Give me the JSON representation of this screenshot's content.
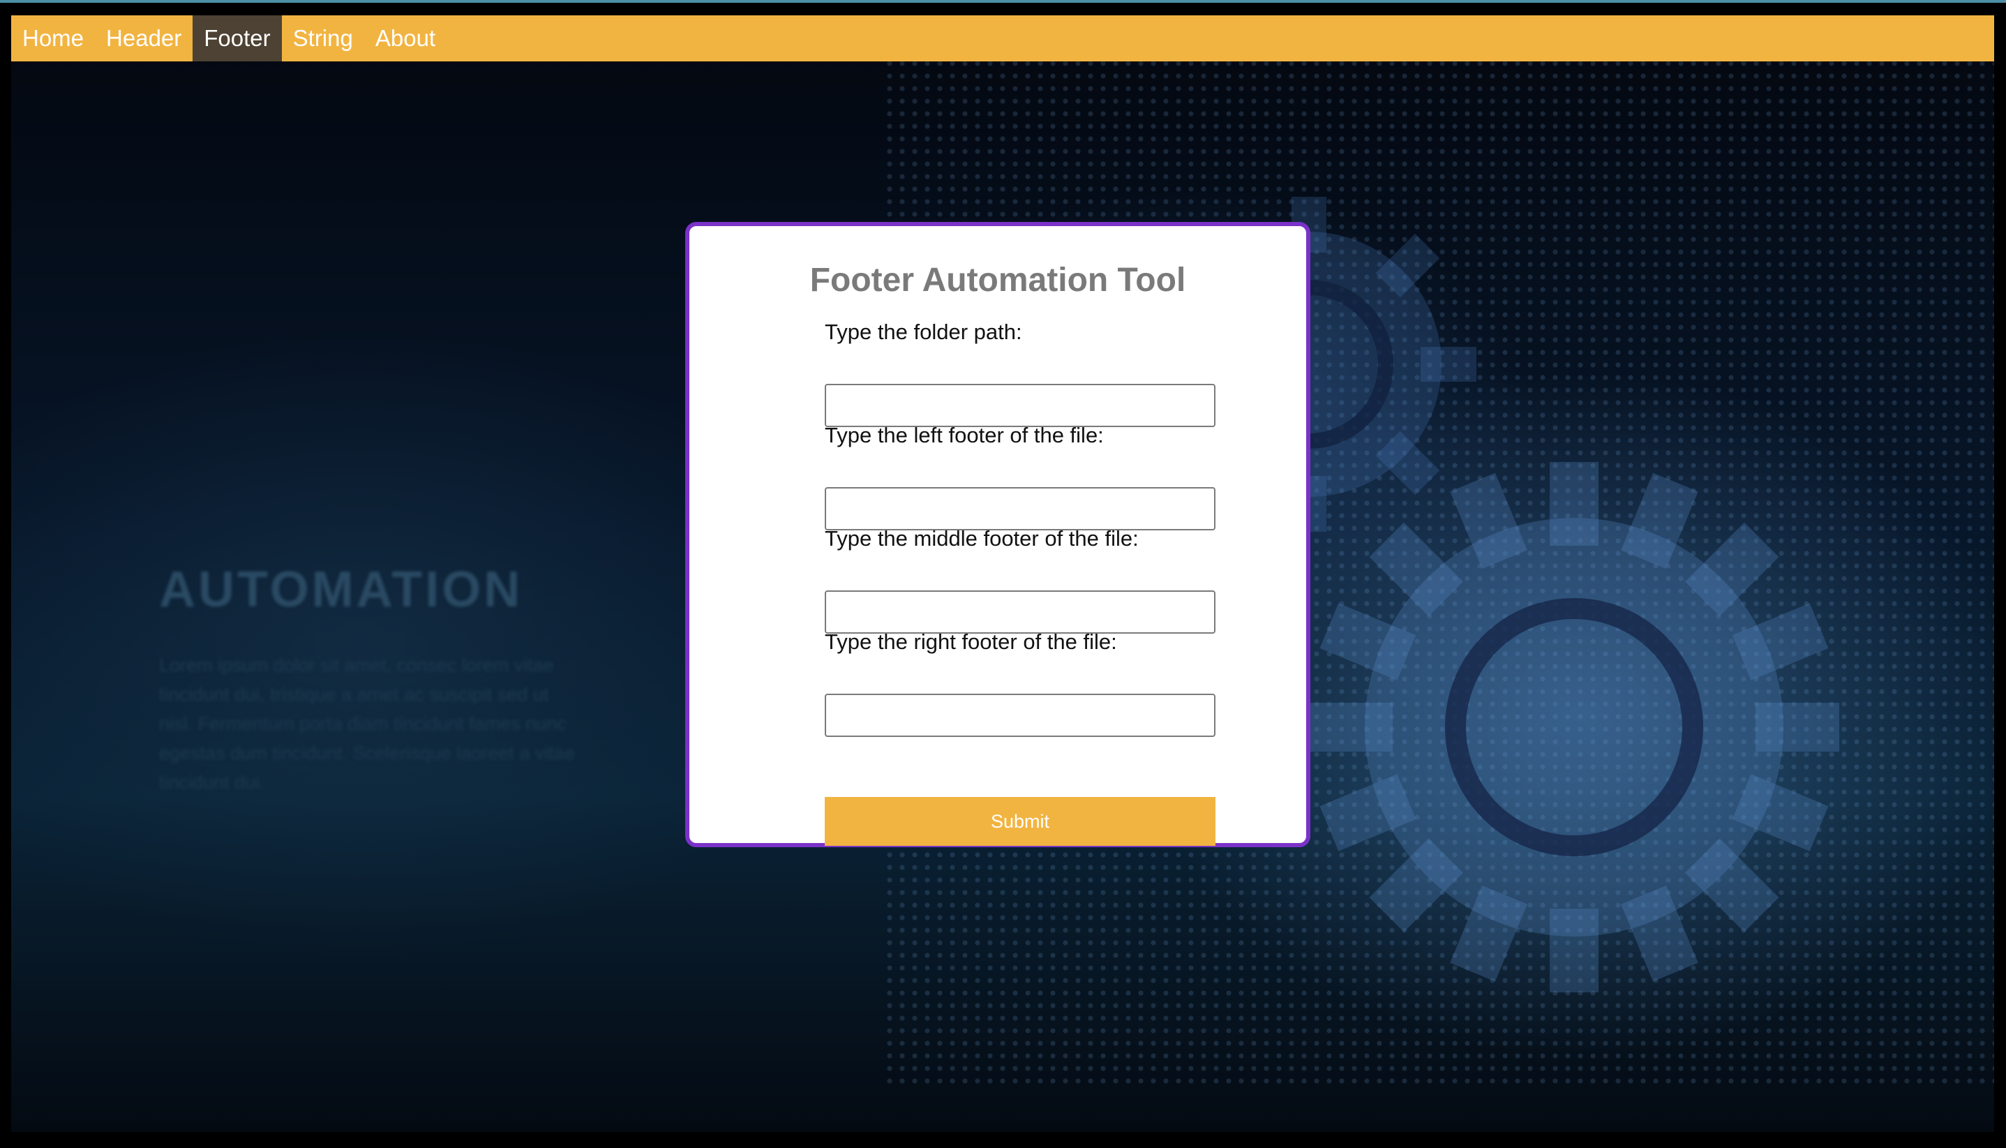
{
  "nav": {
    "items": [
      {
        "label": "Home"
      },
      {
        "label": "Header"
      },
      {
        "label": "Footer",
        "active": true
      },
      {
        "label": "String"
      },
      {
        "label": "About"
      }
    ],
    "bar_color": "#f2b441",
    "active_color": "#4d4233"
  },
  "background": {
    "title": "AUTOMATION",
    "text": "Lorem ipsum dolor sit amet, consec lorem vitae tincidunt dui, tristique a amet ac suscipit sed ut nisl. Fermentum porta diam tincidunt fames nunc egestas dum tincidunt. Scelerisque laoreet a vitae tincidunt dui."
  },
  "form": {
    "title": "Footer Automation Tool",
    "fields": [
      {
        "label": "Type the folder path:",
        "value": ""
      },
      {
        "label": "Type the left footer of the file:",
        "value": ""
      },
      {
        "label": "Type the middle footer of the file:",
        "value": ""
      },
      {
        "label": "Type the right footer of the file:",
        "value": ""
      }
    ],
    "submit_label": "Submit",
    "border_color": "#7a32c8",
    "button_color": "#f2b441"
  }
}
